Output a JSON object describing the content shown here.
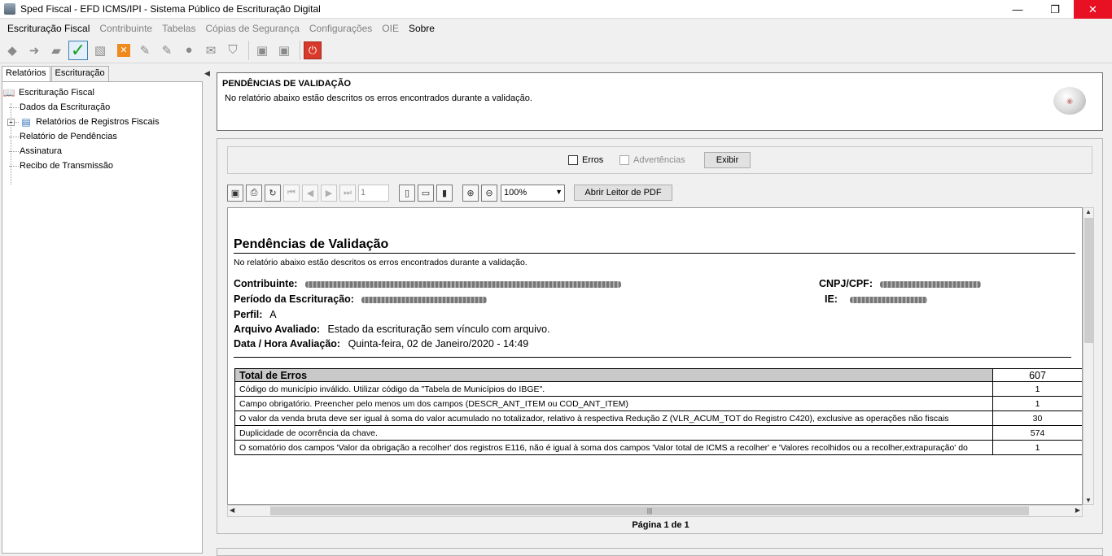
{
  "window": {
    "title": "Sped Fiscal - EFD ICMS/IPI - Sistema Público de Escrituração Digital",
    "minimize": "—",
    "maximize": "❐",
    "close": "✕"
  },
  "menu": [
    {
      "label": "Escrituração Fiscal",
      "enabled": true
    },
    {
      "label": "Contribuinte",
      "enabled": false
    },
    {
      "label": "Tabelas",
      "enabled": false
    },
    {
      "label": "Cópias de Segurança",
      "enabled": false
    },
    {
      "label": "Configurações",
      "enabled": false
    },
    {
      "label": "OIE",
      "enabled": false
    },
    {
      "label": "Sobre",
      "enabled": true
    }
  ],
  "left_tabs": [
    "Relatórios",
    "Escrituração"
  ],
  "tree": {
    "root": "Escrituração Fiscal",
    "items": [
      "Dados da Escrituração",
      "Relatórios de Registros Fiscais",
      "Relatório de Pendências",
      "Assinatura",
      "Recibo de Transmissão"
    ]
  },
  "header": {
    "title": "PENDÊNCIAS DE VALIDAÇÃO",
    "description": "No relatório abaixo estão descritos os erros encontrados durante a validação."
  },
  "filters": {
    "errors_label": "Erros",
    "warnings_label": "Advertências",
    "show_button": "Exibir"
  },
  "viewer": {
    "page_number": "1",
    "zoom": "100%",
    "open_pdf_button": "Abrir Leitor de PDF",
    "page_info": "Página 1 de 1"
  },
  "report": {
    "title": "Pendências de Validação",
    "description": "No relatório abaixo estão descritos os erros encontrados durante a validação.",
    "contribuinte_label": "Contribuinte:",
    "cnpj_label": "CNPJ/CPF:",
    "periodo_label": "Período da Escrituração:",
    "ie_label": "IE:",
    "perfil_label": "Perfil:",
    "perfil_value": "A",
    "arquivo_label": "Arquivo Avaliado:",
    "arquivo_value": "Estado da escrituração sem vínculo com arquivo.",
    "data_label": "Data / Hora Avaliação:",
    "data_value": "Quinta-feira, 02 de Janeiro/2020 - 14:49",
    "total_label": "Total de Erros",
    "total_value": "607",
    "errors": [
      {
        "text": "Código do município inválido. Utilizar código da \"Tabela de Municípios do IBGE\".",
        "count": "1"
      },
      {
        "text": "Campo obrigatório. Preencher pelo menos um dos campos (DESCR_ANT_ITEM ou COD_ANT_ITEM)",
        "count": "1"
      },
      {
        "text": "O valor da venda bruta deve ser igual à soma do valor acumulado no totalizador, relativo à respectiva Redução Z (VLR_ACUM_TOT do Registro C420), exclusive as operações não fiscais",
        "count": "30"
      },
      {
        "text": "Duplicidade de ocorrência da chave.",
        "count": "574"
      },
      {
        "text": "O somatório dos campos 'Valor da obrigação a recolher' dos registros E116,  não é igual à soma dos campos 'Valor total de ICMS a recolher' e 'Valores recolhidos ou a recolher,extrapuração' do",
        "count": "1"
      }
    ]
  },
  "colors": {
    "close_button": "#e81123",
    "table_header": "#c9c9c9",
    "check_green": "#19a019"
  }
}
